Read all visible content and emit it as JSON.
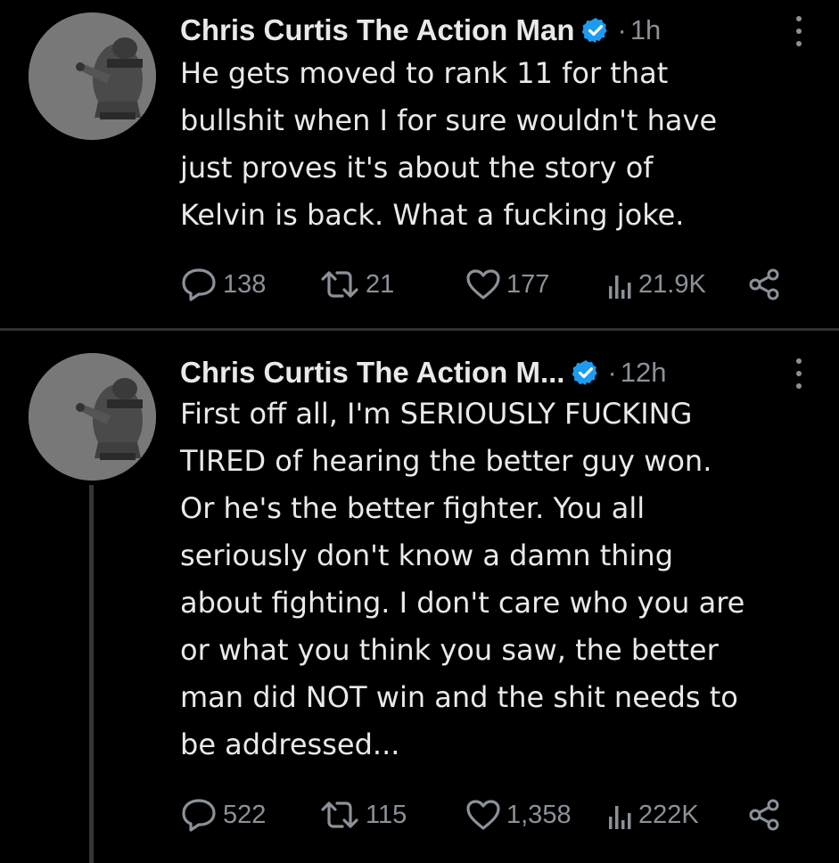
{
  "tweets": [
    {
      "display_name": "Chris Curtis The Action Man",
      "separator": "·",
      "time": "1h",
      "text": "He gets moved to rank 11 for that\nbullshit when I for sure wouldn't have\njust proves it's about the story of\nKelvin is back. What a fucking joke.",
      "replies": "138",
      "reposts": "21",
      "likes": "177",
      "views": "21.9K"
    },
    {
      "display_name": "Chris Curtis The Action M...",
      "separator": "·",
      "time": "12h",
      "text": "First off all, I'm SERIOUSLY FUCKING\nTIRED of hearing the better guy won.\nOr he's the better fighter.  You all\nseriously don't know a damn thing\nabout fighting. I don't care who you are\nor what you think you saw, the better\nman did NOT win and the shit needs to\nbe addressed...",
      "replies": "522",
      "reposts": "115",
      "likes": "1,358",
      "views": "222K"
    }
  ],
  "icons": {
    "verified": "verified-badge-icon",
    "more": "more-options-icon",
    "reply": "reply-icon",
    "repost": "repost-icon",
    "like": "like-icon",
    "views": "views-icon",
    "share": "share-icon"
  },
  "colors": {
    "background": "#000000",
    "primary_text": "#e7e9ea",
    "secondary_text": "#8b9199",
    "verified_blue": "#1d9bf0",
    "divider": "#2f3336"
  }
}
